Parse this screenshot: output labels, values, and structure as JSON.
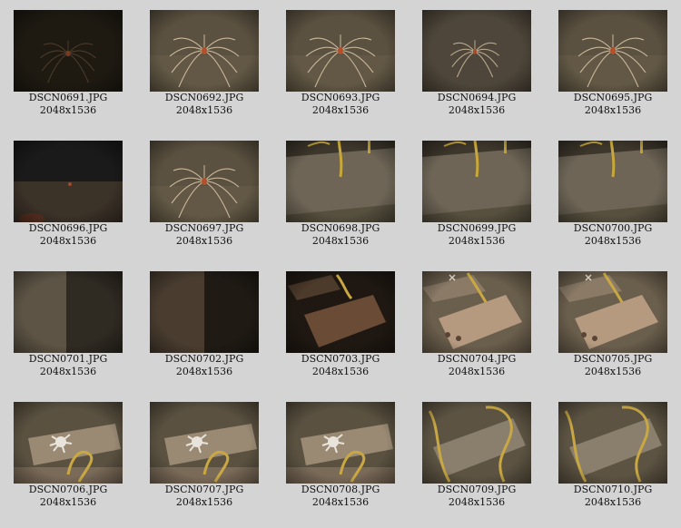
{
  "gallery": {
    "items": [
      {
        "filename": "DSCN0691.JPG",
        "dimensions": "2048x1536",
        "scene": "spider-dark"
      },
      {
        "filename": "DSCN0692.JPG",
        "dimensions": "2048x1536",
        "scene": "spider"
      },
      {
        "filename": "DSCN0693.JPG",
        "dimensions": "2048x1536",
        "scene": "spider"
      },
      {
        "filename": "DSCN0694.JPG",
        "dimensions": "2048x1536",
        "scene": "spider-small"
      },
      {
        "filename": "DSCN0695.JPG",
        "dimensions": "2048x1536",
        "scene": "spider"
      },
      {
        "filename": "DSCN0696.JPG",
        "dimensions": "2048x1536",
        "scene": "seafloor-dark"
      },
      {
        "filename": "DSCN0697.JPG",
        "dimensions": "2048x1536",
        "scene": "spider"
      },
      {
        "filename": "DSCN0698.JPG",
        "dimensions": "2048x1536",
        "scene": "block-closeup"
      },
      {
        "filename": "DSCN0699.JPG",
        "dimensions": "2048x1536",
        "scene": "block-closeup"
      },
      {
        "filename": "DSCN0700.JPG",
        "dimensions": "2048x1536",
        "scene": "block-closeup"
      },
      {
        "filename": "DSCN0701.JPG",
        "dimensions": "2048x1536",
        "scene": "block-edge"
      },
      {
        "filename": "DSCN0702.JPG",
        "dimensions": "2048x1536",
        "scene": "block-edge-dark"
      },
      {
        "filename": "DSCN0703.JPG",
        "dimensions": "2048x1536",
        "scene": "brick-dark"
      },
      {
        "filename": "DSCN0704.JPG",
        "dimensions": "2048x1536",
        "scene": "brick"
      },
      {
        "filename": "DSCN0705.JPG",
        "dimensions": "2048x1536",
        "scene": "brick"
      },
      {
        "filename": "DSCN0706.JPG",
        "dimensions": "2048x1536",
        "scene": "crab-brick"
      },
      {
        "filename": "DSCN0707.JPG",
        "dimensions": "2048x1536",
        "scene": "crab-brick"
      },
      {
        "filename": "DSCN0708.JPG",
        "dimensions": "2048x1536",
        "scene": "crab-brick"
      },
      {
        "filename": "DSCN0709.JPG",
        "dimensions": "2048x1536",
        "scene": "brick-coral"
      },
      {
        "filename": "DSCN0710.JPG",
        "dimensions": "2048x1536",
        "scene": "brick-coral"
      }
    ]
  }
}
